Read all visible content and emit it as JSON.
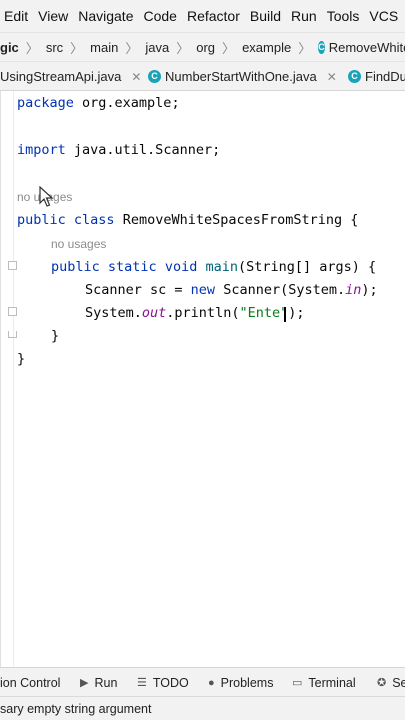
{
  "menu": {
    "items": [
      "Edit",
      "View",
      "Navigate",
      "Code",
      "Refactor",
      "Build",
      "Run",
      "Tools",
      "VCS",
      "W"
    ]
  },
  "breadcrumb": {
    "project": "gic",
    "items": [
      "src",
      "main",
      "java",
      "org",
      "example"
    ],
    "file": "RemoveWhiteSpacesFro"
  },
  "tabs": [
    {
      "label": "UsingStreamApi.java"
    },
    {
      "label": "NumberStartWithOne.java"
    },
    {
      "label": "FindDu"
    }
  ],
  "editor": {
    "line1": {
      "kw": "package",
      "text": " org.example;"
    },
    "line2": {
      "kw": "import",
      "text": " java.util.Scanner;"
    },
    "usage_hint_1": "no usages",
    "line3": {
      "kw1": "public",
      "kw2": "class",
      "text": " RemoveWhiteSpacesFromString {"
    },
    "usage_hint_2": "no usages",
    "line4": {
      "kw1": "public",
      "kw2": "static",
      "kw3": "void",
      "fn": "main",
      "text": "(String[] args) {"
    },
    "line5": {
      "pre": "Scanner sc = ",
      "kw": "new",
      "mid": " Scanner(System.",
      "field": "in",
      "post": ");"
    },
    "line6": {
      "pre": "System.",
      "field": "out",
      "mid": ".println(",
      "str": "\"Ente\"",
      "post": ");"
    },
    "line7": "}",
    "line8": "}"
  },
  "tool_windows": [
    {
      "label": "ion Control",
      "icon": ""
    },
    {
      "label": "Run",
      "icon": "run-icon"
    },
    {
      "label": "TODO",
      "icon": "list-icon"
    },
    {
      "label": "Problems",
      "icon": "problems-icon"
    },
    {
      "label": "Terminal",
      "icon": "terminal-icon"
    },
    {
      "label": "Se",
      "icon": "services-icon"
    }
  ],
  "status": {
    "message": "sary empty string argument"
  },
  "colors": {
    "keyword": "#0033b3",
    "method": "#00627a",
    "string": "#067d17",
    "static_field": "#871094",
    "hint": "#8c8c8c"
  }
}
